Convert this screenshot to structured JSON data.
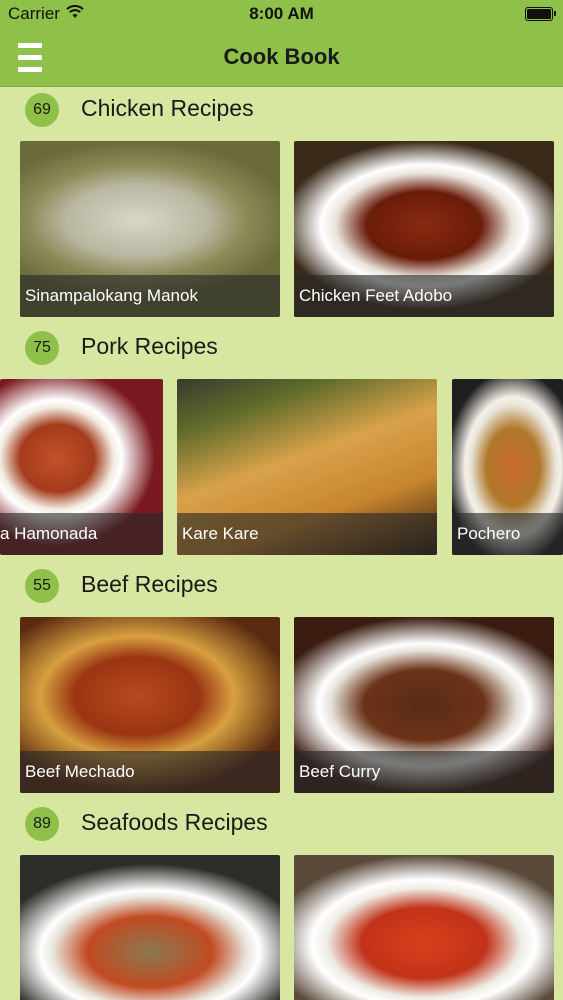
{
  "status_bar": {
    "carrier": "Carrier",
    "time": "8:00 AM"
  },
  "nav": {
    "title": "Cook Book"
  },
  "sections": [
    {
      "count": "69",
      "title": "Chicken Recipes",
      "items": [
        {
          "label": "Sinampalokang Manok",
          "image_icon": "food-photo"
        },
        {
          "label": "Chicken Feet Adobo",
          "image_icon": "food-photo"
        }
      ]
    },
    {
      "count": "75",
      "title": "Pork Recipes",
      "items": [
        {
          "label": "a Hamonada",
          "image_icon": "food-photo"
        },
        {
          "label": "Kare Kare",
          "image_icon": "food-photo"
        },
        {
          "label": "Pochero",
          "image_icon": "food-photo"
        }
      ]
    },
    {
      "count": "55",
      "title": "Beef Recipes",
      "items": [
        {
          "label": "Beef Mechado",
          "image_icon": "food-photo"
        },
        {
          "label": "Beef Curry",
          "image_icon": "food-photo"
        }
      ]
    },
    {
      "count": "89",
      "title": "Seafoods Recipes",
      "items": [
        {
          "label": "",
          "image_icon": "food-photo"
        },
        {
          "label": "",
          "image_icon": "food-photo"
        }
      ]
    }
  ],
  "colors": {
    "bar": "#8fc04a",
    "background": "#d7e6a0",
    "badge": "#8fc04a"
  }
}
